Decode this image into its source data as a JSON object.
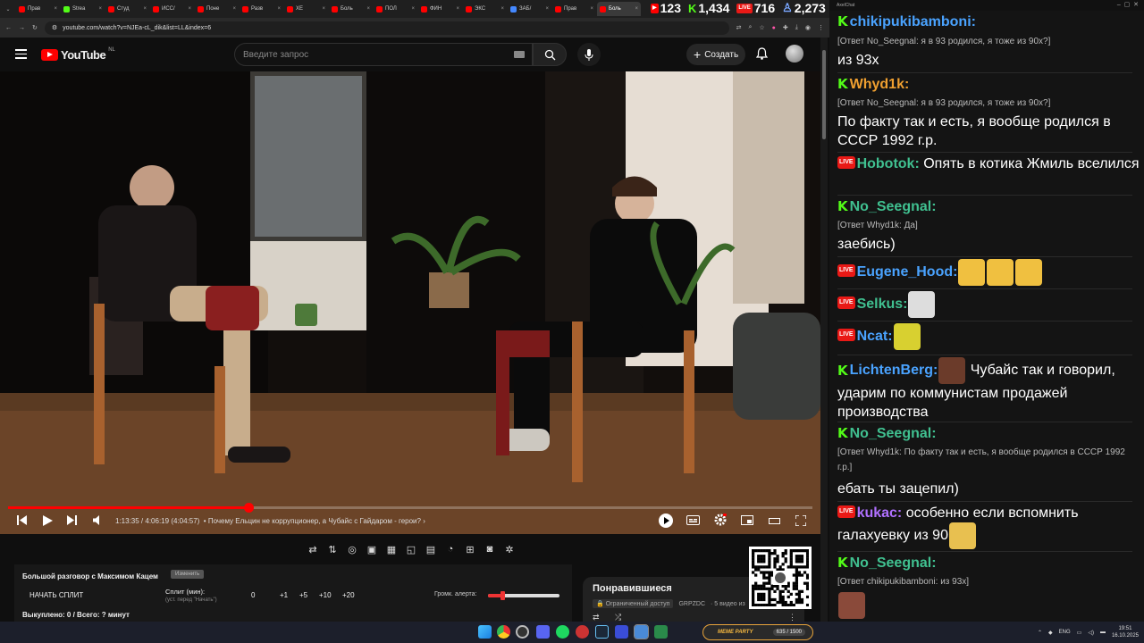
{
  "browser": {
    "tabs": [
      {
        "label": "Прав",
        "color": "#ff0000"
      },
      {
        "label": "Strea",
        "color": "#53fc18"
      },
      {
        "label": "Студ",
        "color": "#ff0000"
      },
      {
        "label": "ИСС/",
        "color": "#ff0000"
      },
      {
        "label": "Поне",
        "color": "#ff0000"
      },
      {
        "label": "Разв",
        "color": "#ff0000"
      },
      {
        "label": "ХЕ",
        "color": "#ff0000"
      },
      {
        "label": "Боль",
        "color": "#ff0000"
      },
      {
        "label": "ПОЛ",
        "color": "#ff0000"
      },
      {
        "label": "ФИН",
        "color": "#ff0000"
      },
      {
        "label": "ЭКС",
        "color": "#ff0000"
      },
      {
        "label": "ЗАБ/",
        "color": "#4488ff"
      },
      {
        "label": "Прав",
        "color": "#ff0000"
      },
      {
        "label": "Боль",
        "color": "#ff0000"
      }
    ],
    "url": "youtube.com/watch?v=NJEa-cL_dik&list=LL&index=6"
  },
  "stream_stats": {
    "youtube_viewers": "123",
    "kick_viewers": "1,434",
    "twitch_viewers": "716",
    "total_viewers": "2,273"
  },
  "youtube": {
    "logo_text": "YouTube",
    "region": "NL",
    "search_placeholder": "Введите запрос",
    "create_label": "Создать"
  },
  "player": {
    "current_time": "1:13:35",
    "duration": "4:06:19",
    "remaining": "(4:04:57)",
    "chapter": "• Почему Ельцин не коррупционер, а Чубайс с Гайдаром - герои?",
    "progress_fraction": 0.299
  },
  "split_panel": {
    "title": "Большой разговор с Максимом Кацем",
    "settings_label": "Изменить",
    "start_split": "НАЧАТЬ СПЛИТ",
    "split_minutes_label": "Сплит (мин):",
    "split_minutes_sub": "(уст. перед \"Начать\")",
    "split_value": "0",
    "increments": [
      "+1",
      "+5",
      "+10",
      "+20"
    ],
    "alert_volume_label": "Громк. алерта:",
    "alert_volume_fraction": 0.2,
    "spent": "Выкуплено: 0 / Всего: ? минут"
  },
  "liked_panel": {
    "title": "Понравившиеся",
    "access": "Ограниченный доступ",
    "owner": "GRPZDC",
    "count": "· 5 видео из"
  },
  "chat": {
    "window_title": "AxelChat",
    "messages": [
      {
        "platform": "kick",
        "user": "chikipukibamboni:",
        "color": "#4aa3ff",
        "reply": "[Ответ No_Seegnal: я в 93 родился, я тоже из 90х?]",
        "text": "из 93х"
      },
      {
        "platform": "kick",
        "user": "Whyd1k:",
        "color": "#f0a030",
        "reply": "[Ответ No_Seegnal: я в 93 родился, я тоже из 90х?]",
        "text": "По факту так и есть, я вообще родился в СССР 1992 г.р."
      },
      {
        "platform": "twitch",
        "user": "Hobotok:",
        "color": "#40c090",
        "text": "Опять в котика Жмиль вселился"
      },
      {
        "platform": "kick",
        "user": "No_Seegnal:",
        "color": "#40c090",
        "reply": "[Ответ Whyd1k: Да]",
        "text": "заебись)"
      },
      {
        "platform": "twitch",
        "user": "Eugene_Hood:",
        "color": "#4aa3ff",
        "text": ""
      },
      {
        "platform": "twitch",
        "user": "Selkus:",
        "color": "#40c090",
        "text": ""
      },
      {
        "platform": "twitch",
        "user": "Ncat:",
        "color": "#4aa3ff",
        "text": ""
      },
      {
        "platform": "kick",
        "user": "LichtenBerg:",
        "color": "#4aa3ff",
        "text": "Чубайс так и говорил, ударим по коммунистам продажей производства"
      },
      {
        "platform": "kick",
        "user": "No_Seegnal:",
        "color": "#40c090",
        "reply": "[Ответ Whyd1k: По факту так и есть, я вообще родился в СССР 1992 г.р.]",
        "text": "ебать ты зацепил)"
      },
      {
        "platform": "twitch",
        "user": "kukac:",
        "color": "#b070ff",
        "text": "особенно если вспомнить галахуевку из 90"
      },
      {
        "platform": "kick",
        "user": "No_Seegnal:",
        "color": "#40c090",
        "reply": "[Ответ chikipukibamboni: из 93х]",
        "text": ""
      }
    ]
  },
  "taskbar": {
    "meme_party": "MEME PARTY",
    "meme_count": "635 / 1500",
    "lang": "ENG",
    "time": "19:51",
    "date": "16.10.2025"
  }
}
